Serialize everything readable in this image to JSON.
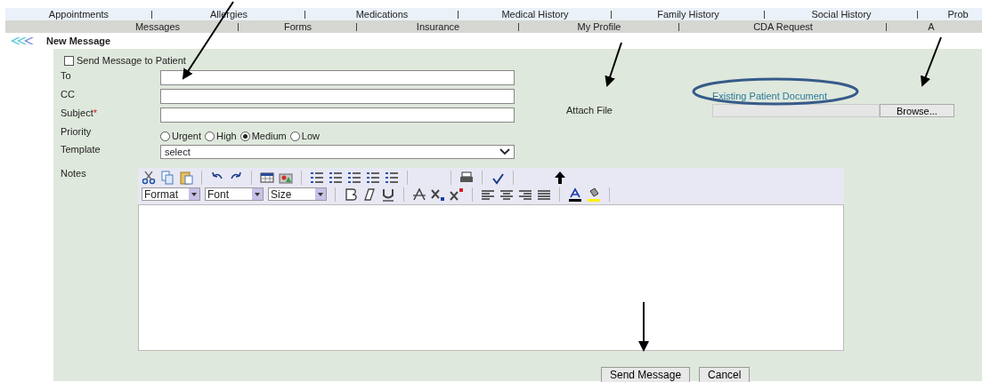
{
  "nav_primary": [
    {
      "label": "Appointments"
    },
    {
      "label": "Allergies"
    },
    {
      "label": "Medications"
    },
    {
      "label": "Medical History"
    },
    {
      "label": "Family History"
    },
    {
      "label": "Social History"
    },
    {
      "label": "Prob"
    }
  ],
  "nav_secondary": [
    {
      "label": "Messages"
    },
    {
      "label": "Forms"
    },
    {
      "label": "Insurance"
    },
    {
      "label": "My Profile"
    },
    {
      "label": "CDA Request"
    },
    {
      "label": "A"
    }
  ],
  "page_title": "New Message",
  "send_to_patient": {
    "label": "Send Message to Patient",
    "checked": false
  },
  "fields": [
    {
      "label": "To"
    },
    {
      "label": "CC"
    },
    {
      "label": "Subject",
      "required_mark": "*"
    }
  ],
  "priority": {
    "label": "Priority",
    "options": [
      {
        "label": "Urgent",
        "selected": false
      },
      {
        "label": "High",
        "selected": false
      },
      {
        "label": "Medium",
        "selected": true
      },
      {
        "label": "Low",
        "selected": false
      }
    ]
  },
  "template": {
    "label": "Template",
    "value": "select"
  },
  "notes": {
    "label": "Notes",
    "dropdowns": [
      "Format",
      "Font",
      "Size"
    ]
  },
  "attach": {
    "label": "Attach File",
    "link": "Existing Patient Document",
    "browse_button": "Browse..."
  },
  "buttons": [
    "Send Message",
    "Cancel"
  ]
}
